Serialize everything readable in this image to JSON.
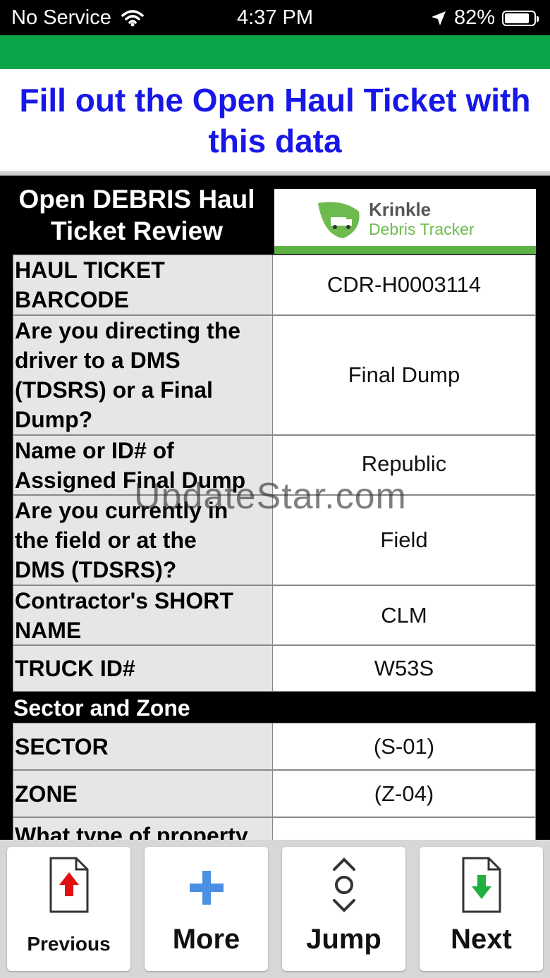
{
  "status_bar": {
    "carrier": "No Service",
    "time": "4:37 PM",
    "battery": "82%"
  },
  "banner": {
    "line1": "Fill out the Open Haul Ticket with",
    "line2": "this data"
  },
  "review": {
    "title_line1": "Open DEBRIS Haul",
    "title_line2": "Ticket Review",
    "logo_line1": "Krinkle",
    "logo_line2": "Debris Tracker",
    "rows": [
      {
        "q": [
          "HAUL TICKET",
          "BARCODE"
        ],
        "a": "CDR-H0003114"
      },
      {
        "q": [
          "Are you directing the",
          "driver to a DMS",
          "(TDSRS) or a Final",
          "Dump?"
        ],
        "a": "Final Dump"
      },
      {
        "q": [
          "Name or ID# of",
          "Assigned Final Dump"
        ],
        "a": "Republic"
      },
      {
        "q": [
          "Are you currently in",
          "the field or at the",
          "DMS (TDSRS)?"
        ],
        "a": "Field"
      },
      {
        "q": [
          "Contractor's SHORT",
          "NAME"
        ],
        "a": "CLM"
      },
      {
        "q": [
          "TRUCK ID#"
        ],
        "a": "W53S"
      }
    ],
    "section_title": "Sector and Zone",
    "sector_rows": [
      {
        "q": [
          "SECTOR"
        ],
        "a": "(S-01)"
      },
      {
        "q": [
          "ZONE"
        ],
        "a": "(Z-04)"
      },
      {
        "q": [
          "What type of property"
        ],
        "a": ""
      }
    ]
  },
  "watermark": "UpdateStar.com",
  "toolbar": {
    "previous": "Previous",
    "more": "More",
    "jump": "Jump",
    "next": "Next"
  },
  "colors": {
    "green": "#08a549",
    "banner_blue": "#1717e8",
    "arrow_red": "#e01010",
    "arrow_green": "#20b040",
    "plus_blue": "#4a90e2"
  }
}
